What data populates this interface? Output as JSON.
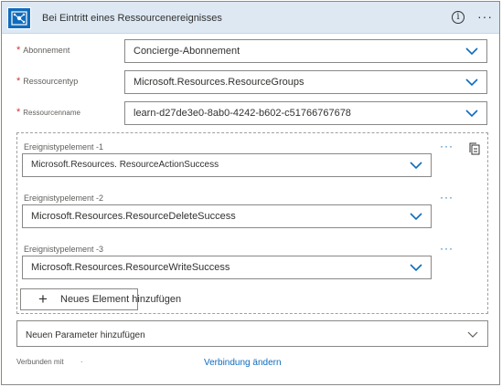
{
  "header": {
    "title": "Bei Eintritt eines Ressourcenereignisses",
    "info_icon": "info-icon",
    "info_glyph": "i",
    "more_glyph": "···",
    "logo_icon": "event-grid-icon"
  },
  "fields": {
    "subscription": {
      "label": "Abonnement",
      "value": "Concierge-Abonnement",
      "required": "*"
    },
    "resource_type": {
      "label": "Ressourcentyp",
      "value": "Microsoft.Resources.ResourceGroups",
      "required": "*"
    },
    "resource_name": {
      "label": "Ressourcenname",
      "value": "learn-d27de3e0-8ab0-4242-b602-c51766767678",
      "required": "*"
    }
  },
  "event_items": [
    {
      "label": "Ereignistypelement -1",
      "value": "Microsoft.Resources. ResourceActionSuccess"
    },
    {
      "label": "Ereignistypelement -2",
      "value": "Microsoft.Resources.ResourceDeleteSuccess"
    },
    {
      "label": "Ereignistypelement -3",
      "value": "Microsoft.Resources.ResourceWriteSuccess"
    }
  ],
  "item_more_glyph": "···",
  "add_item": {
    "label": "Neues Element hinzufügen",
    "plus": "+"
  },
  "add_param": {
    "label": "Neuen Parameter hinzufügen"
  },
  "footer": {
    "connected_label": "Verbunden mit",
    "separator": "·",
    "change_connection": "Verbindung ändern"
  },
  "colors": {
    "accent": "#0f6cbd",
    "header_bg": "#dde8f3",
    "required": "#d13438"
  }
}
